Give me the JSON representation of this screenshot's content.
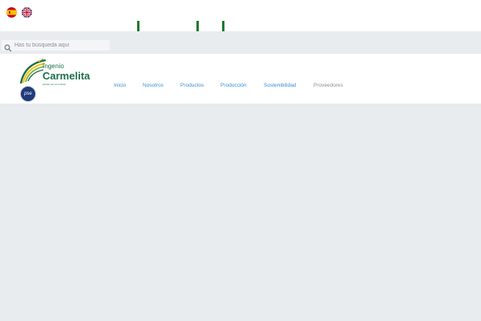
{
  "languages": [
    {
      "name": "Español",
      "icon": "spain-flag-icon"
    },
    {
      "name": "English",
      "icon": "uk-flag-icon"
    }
  ],
  "search": {
    "placeholder": "Has tu búsqueda aquí",
    "value": ""
  },
  "logo": {
    "line1": "Ingenio",
    "line2": "Carmelita",
    "tagline": "azúcar con el corazón",
    "pse_label": "pse"
  },
  "nav": {
    "items": [
      {
        "label": "Inicio"
      },
      {
        "label": "Nosotros"
      },
      {
        "label": "Productos"
      },
      {
        "label": "Producción"
      },
      {
        "label": "Sostenibilidad"
      },
      {
        "label": "Proveedores"
      }
    ]
  },
  "colors": {
    "brand_green": "#1d6f4a",
    "accent_green": "#1f7a2c",
    "nav_link": "#3a8fd0",
    "nav_link_muted": "#8a8f96",
    "page_bg": "#e8ecef"
  }
}
